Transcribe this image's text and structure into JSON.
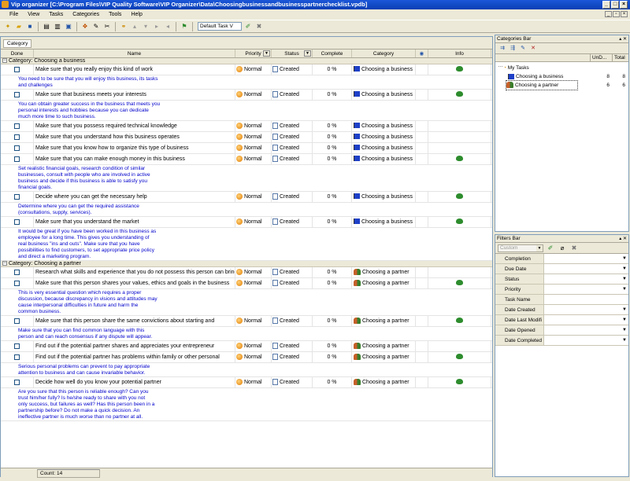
{
  "window": {
    "title": "Vip organizer [C:\\Program Files\\VIP Quality Software\\VIP Organizer\\Data\\Choosingbusinessandbusinesspartnerchecklist.vpdb]"
  },
  "menu": [
    "File",
    "View",
    "Tasks",
    "Categories",
    "Tools",
    "Help"
  ],
  "toolbar": {
    "view_select": "Default Task V"
  },
  "grouping": {
    "chip": "Category"
  },
  "columns": {
    "done": "Done",
    "name": "Name",
    "priority": "Priority",
    "status": "Status",
    "complete": "Complete",
    "category": "Category",
    "info": "Info"
  },
  "groups": [
    {
      "label": "Category: Choosing a business",
      "tasks": [
        {
          "name": "Make sure that you really enjoy this kind of work",
          "priority": "Normal",
          "status": "Created",
          "complete": "0 %",
          "category": "Choosing a business",
          "info": true,
          "note": "You need to be sure that you will enjoy this business, its tasks\nand challenges"
        },
        {
          "name": "Make sure that business meets your interests",
          "priority": "Normal",
          "status": "Created",
          "complete": "0 %",
          "category": "Choosing a business",
          "info": true,
          "note": "You can obtain greater success in the business that meets you\npersonal interests and hobbies because you can dedicate\nmuch more time to such business."
        },
        {
          "name": "Make sure that you possess required technical knowledge",
          "priority": "Normal",
          "status": "Created",
          "complete": "0 %",
          "category": "Choosing a business",
          "info": false,
          "note": ""
        },
        {
          "name": "Make sure that you understand how this business operates",
          "priority": "Normal",
          "status": "Created",
          "complete": "0 %",
          "category": "Choosing a business",
          "info": false,
          "note": ""
        },
        {
          "name": "Make sure that you know how to organize this type of business",
          "priority": "Normal",
          "status": "Created",
          "complete": "0 %",
          "category": "Choosing a business",
          "info": false,
          "note": ""
        },
        {
          "name": "Make sure that you can make enough money in this business",
          "priority": "Normal",
          "status": "Created",
          "complete": "0 %",
          "category": "Choosing a business",
          "info": true,
          "note": "Set realistic financial goals, research condition of similar\nbusinesses, consult with people who are involved in active\nbusiness and decide if this business is able to satisfy you\nfinancial goals."
        },
        {
          "name": "Decide where you can get the necessary help",
          "priority": "Normal",
          "status": "Created",
          "complete": "0 %",
          "category": "Choosing a business",
          "info": true,
          "note": "Determine where you can get the required assistance\n(consultations, supply, services)."
        },
        {
          "name": "Make sure that you understand the market",
          "priority": "Normal",
          "status": "Created",
          "complete": "0 %",
          "category": "Choosing a business",
          "info": true,
          "note": "It would be great if you have been worked in this business as\nemployee for a long time. This gives you understanding of\nreal business \"ins and outs\". Make sure that you have\npossibilities to find customers, to set appropriate price policy\nand direct a marketing program."
        }
      ]
    },
    {
      "label": "Category: Choosing a partner",
      "tasks": [
        {
          "name": "Research  what skills and experience that you do not possess this person can bring",
          "priority": "Normal",
          "status": "Created",
          "complete": "0 %",
          "category": "Choosing a partner",
          "info": false,
          "note": ""
        },
        {
          "name": "Make sure that this person shares your values, ethics and goals in the business",
          "priority": "Normal",
          "status": "Created",
          "complete": "0 %",
          "category": "Choosing a partner",
          "info": true,
          "note": "This is very essential question which requires a proper\ndiscussion, because discrepancy in visions and attitudes may\ncause interpersonal difficulties in future and harm the\ncommon business."
        },
        {
          "name": "Make sure that this person share the same convictions about starting and",
          "priority": "Normal",
          "status": "Created",
          "complete": "0 %",
          "category": "Choosing a partner",
          "info": true,
          "note": "Make sure that you can find common language with this\nperson and can reach consensus if any dispute will appear."
        },
        {
          "name": "Find out if the potential partner shares and appreciates your entrepreneur",
          "priority": "Normal",
          "status": "Created",
          "complete": "0 %",
          "category": "Choosing a partner",
          "info": false,
          "note": ""
        },
        {
          "name": "Find out if the potential partner has problems within family or other personal",
          "priority": "Normal",
          "status": "Created",
          "complete": "0 %",
          "category": "Choosing a partner",
          "info": true,
          "note": "Serious personal problems can prevent to pay appropriate\nattention to business and can cause invariable behavior."
        },
        {
          "name": "Decide how well do you know your potential partner",
          "priority": "Normal",
          "status": "Created",
          "complete": "0 %",
          "category": "Choosing a partner",
          "info": true,
          "note": "Are you sure that this person is reliable enough? Can you\ntrust him/her fully? Is he/she ready to share with you not\nonly success, but failures as well? Has this person been in a\npartnership before? Do not make a quick decision. An\nineffective partner is much worse than no partner at all."
        }
      ]
    }
  ],
  "status": {
    "count": "Count: 14"
  },
  "categories_bar": {
    "title": "Categories Bar",
    "col_undone": "UnD...",
    "col_total": "Total",
    "items": [
      {
        "label": "My Tasks",
        "undone": "",
        "total": ""
      },
      {
        "label": "Choosing a business",
        "undone": "8",
        "total": "8"
      },
      {
        "label": "Choosing a partner",
        "undone": "6",
        "total": "6"
      }
    ]
  },
  "filters_bar": {
    "title": "Filters Bar",
    "combo": "Custom",
    "filters": [
      "Completion",
      "Due Date",
      "Status",
      "Priority",
      "Task Name",
      "Date Created",
      "Date Last Modifi",
      "Date Opened",
      "Date Completed"
    ]
  },
  "colors": {
    "title_bg": "#0a3fb4",
    "note_text": "#0000cc",
    "chrome": "#ece9d8"
  }
}
